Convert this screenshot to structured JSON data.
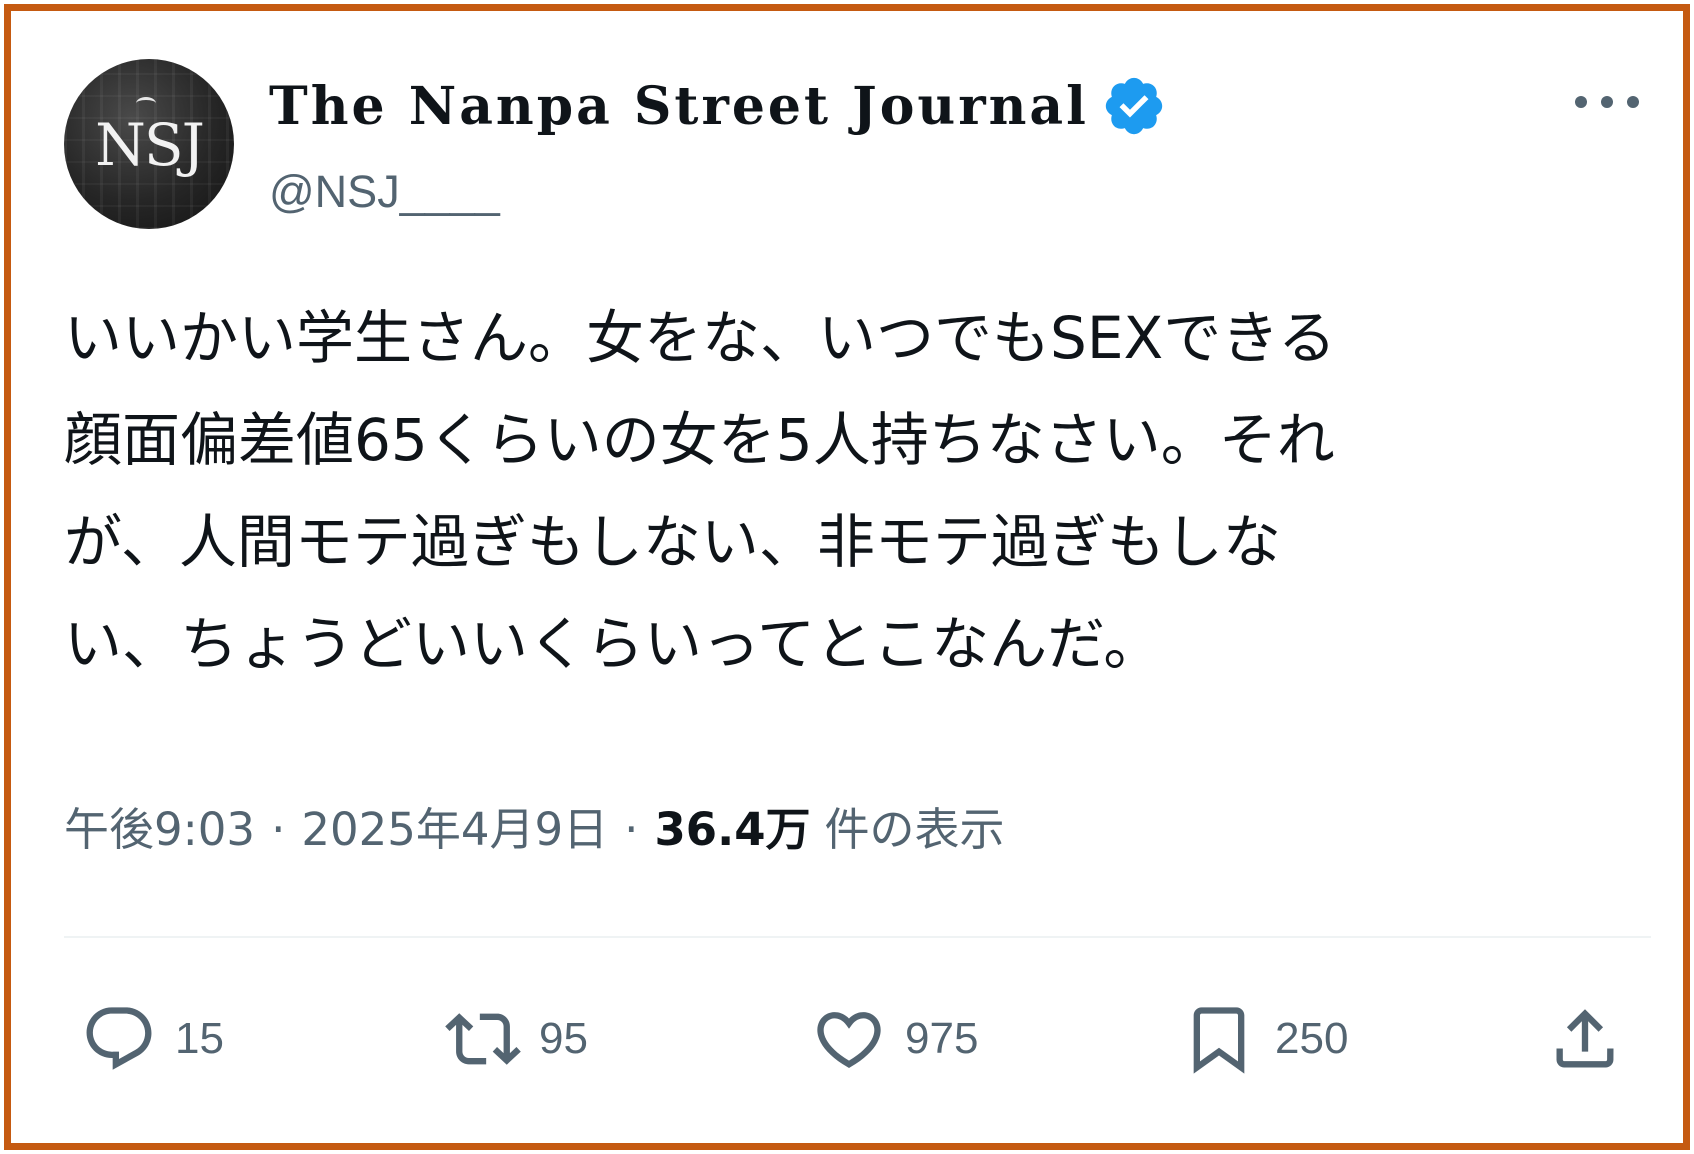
{
  "author": {
    "avatar_text": "NSJ",
    "display_name": "The Nanpa Street Journal",
    "handle": "@NSJ____",
    "verified_icon": "verified-badge-icon",
    "verified_color": "#1d9bf0"
  },
  "more_icon": "more-horizontal-icon",
  "tweet": {
    "lines": [
      "いいかい学生さん。女をな、いつでもSEXできる",
      "顔面偏差値65くらいの女を5人持ちなさい。それ",
      "が、人間モテ過ぎもしない、非モテ過ぎもしな",
      "い、ちょうどいいくらいってとこなんだ。"
    ]
  },
  "meta": {
    "time": "午後9:03",
    "date": "2025年4月9日",
    "separator": "·",
    "views_count": "36.4万",
    "views_label": "件の表示"
  },
  "actions": {
    "reply": {
      "icon": "reply-icon",
      "count": "15"
    },
    "retweet": {
      "icon": "retweet-icon",
      "count": "95"
    },
    "like": {
      "icon": "heart-icon",
      "count": "975"
    },
    "bookmark": {
      "icon": "bookmark-icon",
      "count": "250"
    },
    "share": {
      "icon": "share-icon"
    }
  },
  "colors": {
    "frame_border": "#c55a11",
    "text_primary": "#0f1419",
    "text_secondary": "#536471",
    "divider": "#eff3f4"
  }
}
